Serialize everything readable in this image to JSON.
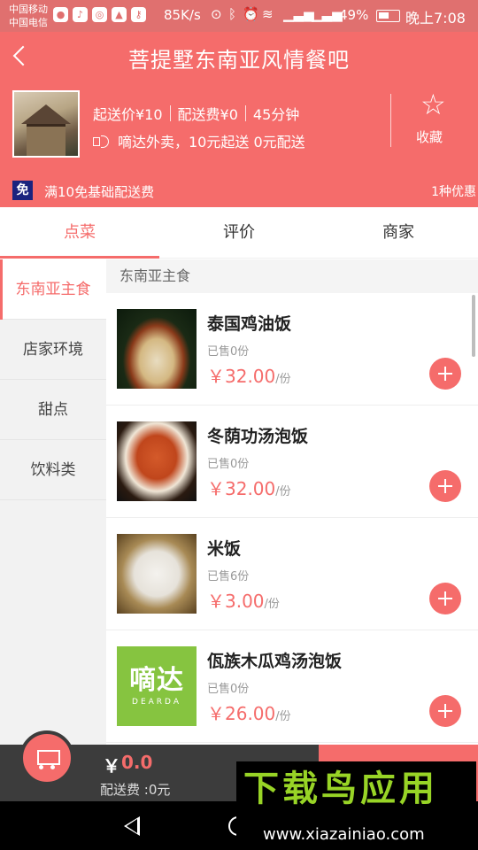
{
  "status_bar": {
    "carrier1": "中国移动",
    "carrier2": "中国电信",
    "speed": "85K/s",
    "battery": "49%",
    "time": "晚上7:08"
  },
  "header": {
    "title": "菩提墅东南亚风情餐吧",
    "min_order": "起送价¥10",
    "delivery_fee": "配送费¥0",
    "delivery_time": "45分钟",
    "announcement": "嘀达外卖，10元起送 0元配送",
    "favorite_label": "收藏",
    "promo_badge": "免",
    "promo_text": "满10免基础配送费",
    "promo_count": "1种优惠"
  },
  "tabs": [
    {
      "label": "点菜"
    },
    {
      "label": "评价"
    },
    {
      "label": "商家"
    }
  ],
  "categories": [
    {
      "label": "东南亚主食"
    },
    {
      "label": "店家环境"
    },
    {
      "label": "甜点"
    },
    {
      "label": "饮料类"
    }
  ],
  "section_title": "东南亚主食",
  "foods": [
    {
      "name": "泰国鸡油饭",
      "sold": "已售0份",
      "price": "￥32.00",
      "unit": "/份"
    },
    {
      "name": "冬荫功汤泡饭",
      "sold": "已售0份",
      "price": "￥32.00",
      "unit": "/份"
    },
    {
      "name": "米饭",
      "sold": "已售6份",
      "price": "￥3.00",
      "unit": "/份"
    },
    {
      "name": "佤族木瓜鸡汤泡饭",
      "sold": "已售0份",
      "price": "￥26.00",
      "unit": "/份",
      "logo_text": "嘀达",
      "logo_sub": "DEARDA"
    }
  ],
  "cart": {
    "currency": "￥",
    "total": "0.0",
    "fee": "配送费 :0元"
  },
  "watermark": {
    "title": "下载鸟应用",
    "url": "www.xiazainiao.com"
  },
  "colors": {
    "accent": "#f56c6b",
    "statusbar": "#e0706f",
    "cartbar": "#3c3c3c",
    "badge": "#1a237e"
  }
}
